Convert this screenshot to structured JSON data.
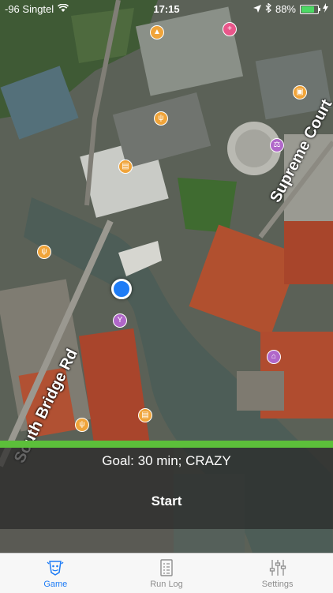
{
  "status_bar": {
    "carrier": "-96 Singtel",
    "time": "17:15",
    "battery": "88%",
    "battery_level": 0.88
  },
  "map": {
    "streets": [
      "South Bridge Rd",
      "Supreme Court"
    ],
    "pois": [
      {
        "icon": "landmark-icon"
      },
      {
        "icon": "restaurant-icon"
      },
      {
        "icon": "restaurant-icon"
      },
      {
        "icon": "restaurant-icon"
      },
      {
        "icon": "shopping-icon"
      },
      {
        "icon": "court-icon"
      },
      {
        "icon": "bar-icon"
      },
      {
        "icon": "shop-icon"
      },
      {
        "icon": "hotel-icon"
      },
      {
        "icon": "medical-icon"
      }
    ]
  },
  "run_panel": {
    "goal": "Goal: 30 min; CRAZY",
    "start_label": "Start",
    "progress_color": "#5cbf3a"
  },
  "tabbar": {
    "tabs": [
      {
        "label": "Game",
        "icon": "game-icon",
        "active": true
      },
      {
        "label": "Run Log",
        "icon": "run-log-icon",
        "active": false
      },
      {
        "label": "Settings",
        "icon": "settings-icon",
        "active": false
      }
    ],
    "accent": "#1e7cf6"
  }
}
